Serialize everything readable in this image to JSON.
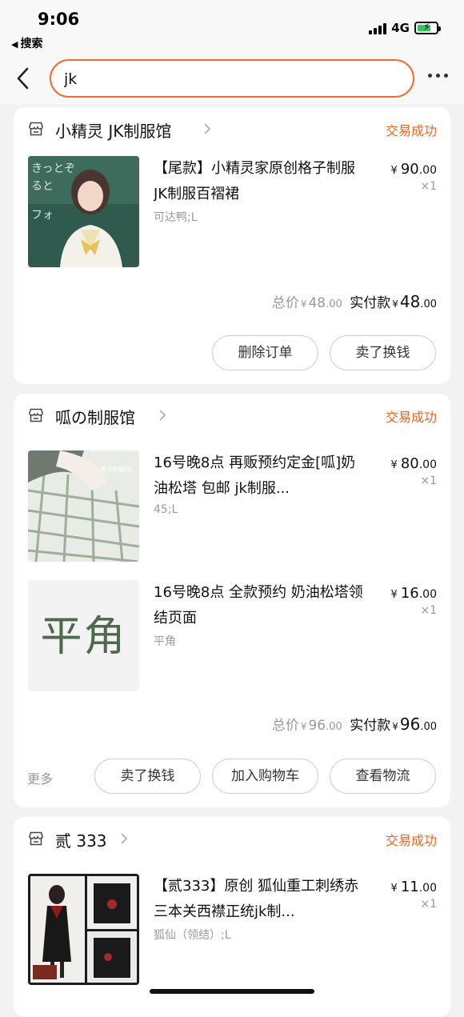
{
  "status_bar": {
    "time": "9:06",
    "back_app": "搜索",
    "network": "4G"
  },
  "search": {
    "value": "jk"
  },
  "orders": [
    {
      "shop": "小精灵 JK制服馆",
      "status": "交易成功",
      "items": [
        {
          "title": "【尾款】小精灵家原创格子制服 JK制服百褶裙",
          "sku": "可达鸭;L",
          "price_int": "90",
          "price_dec": ".00",
          "qty": "×1"
        }
      ],
      "total_label": "总价",
      "total_int": "48",
      "total_dec": ".00",
      "paid_label": "实付款",
      "paid_int": "48",
      "paid_dec": ".00",
      "buttons": [
        "删除订单",
        "卖了换钱"
      ]
    },
    {
      "shop": "呱の制服馆",
      "status": "交易成功",
      "items": [
        {
          "title": "16号晚8点 再贩预约定金[呱]奶油松塔 包邮 jk制服...",
          "sku": "45;L",
          "price_int": "80",
          "price_dec": ".00",
          "qty": "×1",
          "thumb_text": "呱の制服馆"
        },
        {
          "title": "16号晚8点 全款预约 奶油松塔领结页面",
          "sku": "平角",
          "price_int": "16",
          "price_dec": ".00",
          "qty": "×1",
          "thumb_text": "平角"
        }
      ],
      "total_label": "总价",
      "total_int": "96",
      "total_dec": ".00",
      "paid_label": "实付款",
      "paid_int": "96",
      "paid_dec": ".00",
      "more": "更多",
      "buttons": [
        "卖了换钱",
        "加入购物车",
        "查看物流"
      ]
    },
    {
      "shop": "贰 333",
      "status": "交易成功",
      "items": [
        {
          "title": "【贰333】原创 狐仙重工刺绣赤三本关西襟正统jk制...",
          "sku": "狐仙（领结）;L",
          "price_int": "11",
          "price_dec": ".00",
          "qty": "×1"
        }
      ]
    }
  ],
  "currency": "¥",
  "colors": {
    "accent": "#f26b2a",
    "status": "#f2641e",
    "muted": "#999999"
  }
}
